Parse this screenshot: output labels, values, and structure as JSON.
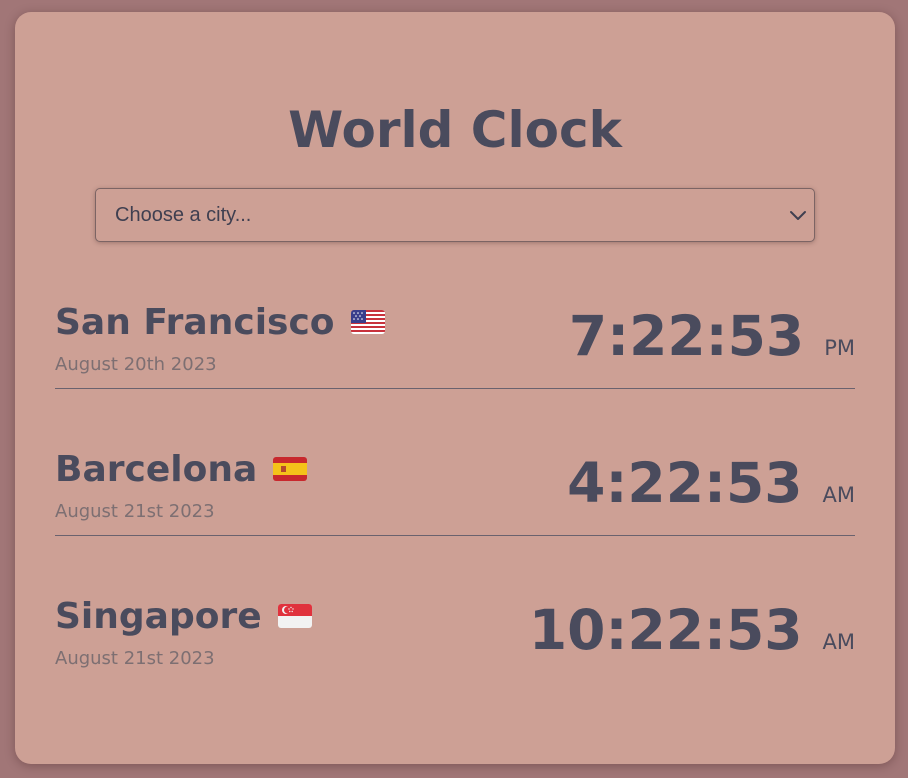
{
  "app": {
    "title": "World Clock"
  },
  "city_select": {
    "placeholder": "Choose a city..."
  },
  "cities": [
    {
      "name": "San Francisco",
      "flag": "us-flag-icon",
      "date": "August 20th 2023",
      "time": "7:22:53",
      "ampm": "PM"
    },
    {
      "name": "Barcelona",
      "flag": "es-flag-icon",
      "date": "August 21st 2023",
      "time": "4:22:53",
      "ampm": "AM"
    },
    {
      "name": "Singapore",
      "flag": "sg-flag-icon",
      "date": "August 21st 2023",
      "time": "10:22:53",
      "ampm": "AM"
    }
  ],
  "colors": {
    "page_bg": "#a17677",
    "card_bg": "#cda095",
    "text": "#4a4b5d",
    "muted_text": "#7d6f72",
    "divider": "#6a626e"
  }
}
